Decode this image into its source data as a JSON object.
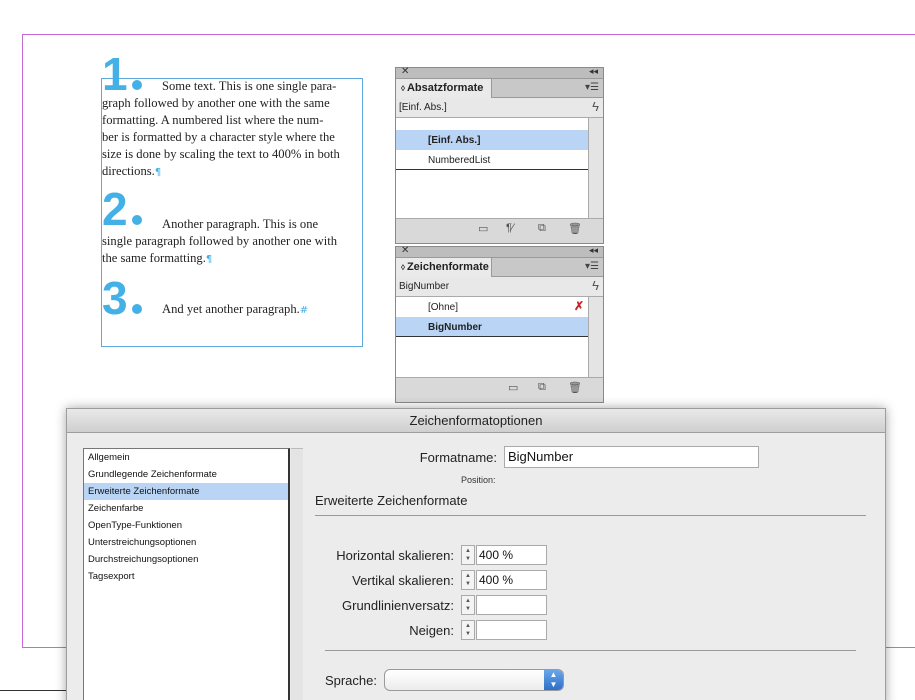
{
  "document": {
    "paragraphs": [
      {
        "number": "1",
        "lines": [
          "Some text. This is one single para-",
          "graph followed by another one with the same",
          "formatting. A numbered list where the num-",
          "ber is formatted by a character style where the",
          "size is done by scaling the text to 400% in both",
          "directions."
        ],
        "end_mark": "¶"
      },
      {
        "number": "2",
        "lines": [
          "Another paragraph. This is one",
          "single paragraph followed by another one with",
          "the same formatting."
        ],
        "end_mark": "¶"
      },
      {
        "number": "3",
        "lines": [
          "And yet another paragraph."
        ],
        "end_mark": "#"
      }
    ]
  },
  "paragraph_panel": {
    "tab": "Absatzformate",
    "current": "[Einf. Abs.]",
    "items": [
      {
        "label": "[Einf. Abs.]",
        "selected": true
      },
      {
        "label": "NumberedList",
        "selected": false
      }
    ]
  },
  "character_panel": {
    "tab": "Zeichenformate",
    "current": "BigNumber",
    "items": [
      {
        "label": "[Ohne]",
        "selected": false
      },
      {
        "label": "BigNumber",
        "selected": true
      }
    ]
  },
  "dialog": {
    "title": "Zeichenformatoptionen",
    "categories": [
      {
        "label": "Allgemein",
        "selected": false
      },
      {
        "label": "Grundlegende Zeichenformate",
        "selected": false
      },
      {
        "label": "Erweiterte Zeichenformate",
        "selected": true
      },
      {
        "label": "Zeichenfarbe",
        "selected": false
      },
      {
        "label": "OpenType-Funktionen",
        "selected": false
      },
      {
        "label": "Unterstreichungsoptionen",
        "selected": false
      },
      {
        "label": "Durchstreichungsoptionen",
        "selected": false
      },
      {
        "label": "Tagsexport",
        "selected": false
      }
    ],
    "formatname_label": "Formatname:",
    "formatname_value": "BigNumber",
    "position_label": "Position:",
    "section_title": "Erweiterte Zeichenformate",
    "fields": [
      {
        "label": "Horizontal skalieren:",
        "value": "400 %"
      },
      {
        "label": "Vertikal skalieren:",
        "value": "400 %"
      },
      {
        "label": "Grundlinienversatz:",
        "value": ""
      },
      {
        "label": "Neigen:",
        "value": ""
      }
    ],
    "language_label": "Sprache:",
    "language_value": ""
  },
  "colors": {
    "accent_blue": "#43b0e6",
    "selection": "#b9d4f5",
    "margin_guide": "#c86ad6"
  }
}
